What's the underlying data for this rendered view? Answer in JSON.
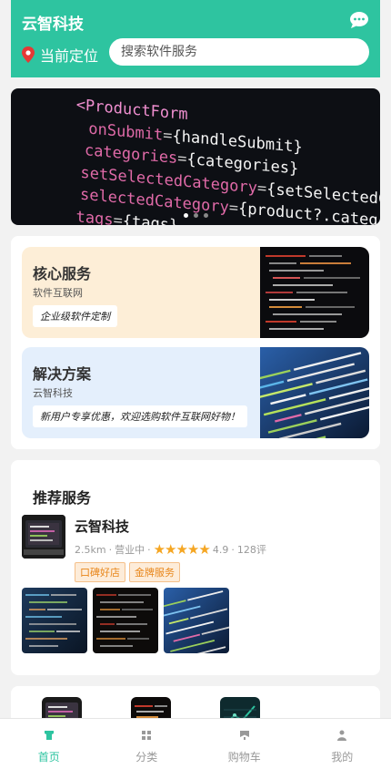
{
  "header": {
    "title": "云智科技",
    "location_label": "当前定位"
  },
  "search": {
    "placeholder": "搜索软件服务"
  },
  "banner": {
    "lines": [
      {
        "attr": "<ProductForm",
        "val": ""
      },
      {
        "attr": "onSubmit",
        "val": "{handleSubmit}"
      },
      {
        "attr": "categories",
        "val": "{categories}"
      },
      {
        "attr": "setSelectedCategory",
        "val": "{setSelectedCat"
      },
      {
        "attr": "selectedCategory",
        "val": "{product?.categ"
      },
      {
        "attr": "tags",
        "val": "{tags}"
      }
    ],
    "dots": 3,
    "active_dot": 0
  },
  "cards": [
    {
      "title": "核心服务",
      "subtitle": "软件互联网",
      "tag": "企业级软件定制"
    },
    {
      "title": "解决方案",
      "subtitle": "云智科技",
      "tag": "新用户专享优惠，欢迎选购软件互联网好物！"
    }
  ],
  "recommend": {
    "title": "推荐服务",
    "shop": {
      "name": "云智科技",
      "distance": "2.5km",
      "status": "营业中",
      "stars": "★★★★★",
      "rating": "4.9",
      "reviews": "128评",
      "badges": [
        "口碑好店",
        "金牌服务"
      ]
    }
  },
  "tabbar": {
    "items": [
      {
        "label": "首页",
        "icon": "home-icon"
      },
      {
        "label": "分类",
        "icon": "grid-icon"
      },
      {
        "label": "购物车",
        "icon": "cart-icon"
      },
      {
        "label": "我的",
        "icon": "user-icon"
      }
    ],
    "active": 0
  },
  "colors": {
    "brand": "#2ec4a0",
    "star": "#f5a623",
    "badge": "#e8861a"
  }
}
